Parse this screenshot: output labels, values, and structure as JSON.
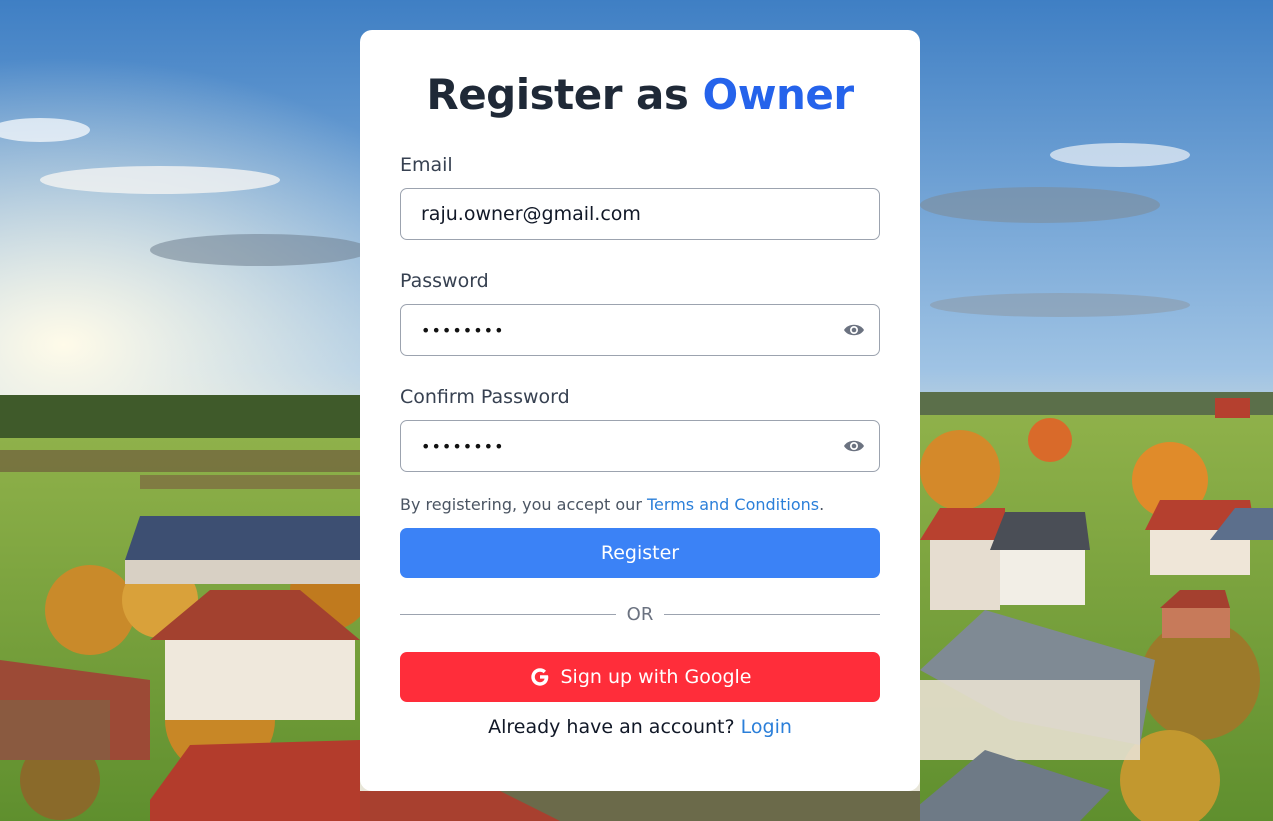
{
  "title": {
    "prefix": "Register as",
    "accent": "Owner"
  },
  "form": {
    "email_label": "Email",
    "email_value": "raju.owner@gmail.com",
    "password_label": "Password",
    "password_mask": "••••••••",
    "confirm_label": "Confirm Password",
    "confirm_mask": "••••••••",
    "toggle_icon": "eye-icon"
  },
  "terms": {
    "text": "By registering, you accept our",
    "link": "Terms and Conditions",
    "suffix": "."
  },
  "buttons": {
    "register": "Register",
    "or": "OR",
    "google": "Sign up with Google",
    "google_icon": "google-g-icon"
  },
  "footer": {
    "text": "Already have an account?",
    "link": "Login"
  },
  "colors": {
    "accent": "#2563eb",
    "register_bg": "#3b82f6",
    "google_bg": "#ff2d3a",
    "link": "#2b7fd9"
  }
}
